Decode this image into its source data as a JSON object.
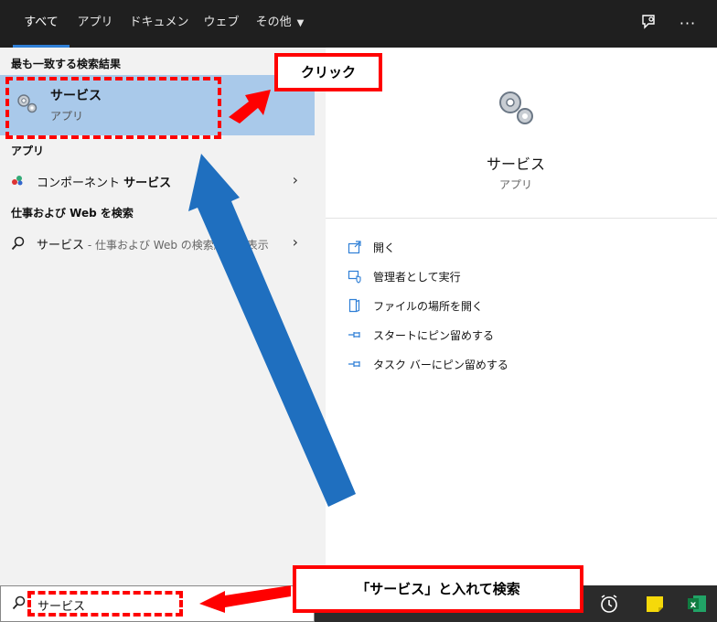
{
  "tabs": [
    {
      "label": "すべて",
      "active": true
    },
    {
      "label": "アプリ",
      "active": false
    },
    {
      "label": "ドキュメント",
      "active": false
    },
    {
      "label": "ウェブ",
      "active": false
    },
    {
      "label": "その他",
      "active": false,
      "dropdown": true
    }
  ],
  "top_icons": [
    "feedback-icon",
    "more-icon"
  ],
  "left": {
    "best_match_header": "最も一致する検索結果",
    "best_match": {
      "title": "サービス",
      "subtitle": "アプリ",
      "icon": "gears-icon"
    },
    "apps_header": "アプリ",
    "apps_item": {
      "text_pre": "コンポーネント ",
      "text_bold": "サービス",
      "icon": "component-services-icon"
    },
    "web_header": "仕事および Web を検索",
    "web_item": {
      "text": "サービス",
      "suffix": " - 仕事および Web の検索結果を表示",
      "icon": "search-icon"
    }
  },
  "right": {
    "title": "サービス",
    "subtitle": "アプリ",
    "actions": [
      {
        "label": "開く",
        "icon": "open-icon"
      },
      {
        "label": "管理者として実行",
        "icon": "shield-icon"
      },
      {
        "label": "ファイルの場所を開く",
        "icon": "folder-icon"
      },
      {
        "label": "スタートにピン留めする",
        "icon": "pin-icon"
      },
      {
        "label": "タスク バーにピン留めする",
        "icon": "pin-icon"
      }
    ]
  },
  "taskbar": {
    "search_value": "サービス",
    "icons": [
      "alarms-icon",
      "sticky-notes-icon",
      "excel-icon"
    ],
    "excel_label": "x"
  },
  "annotations": {
    "click_label": "クリック",
    "search_label": "「サービス」と入れて検索"
  },
  "colors": {
    "accent": "#2f7fd6",
    "highlight": "#a9c9ea",
    "annotation_red": "#ff0000",
    "arrow_blue": "#1f6fbf"
  }
}
